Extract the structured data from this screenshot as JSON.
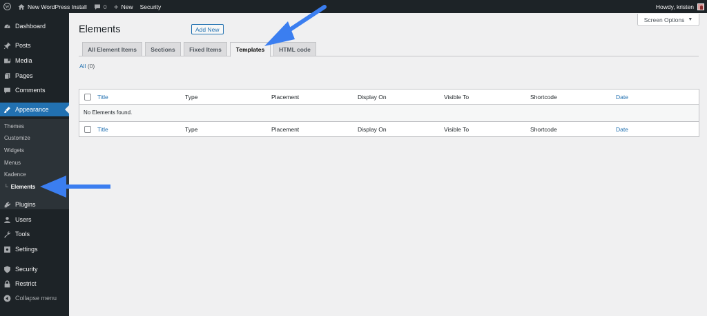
{
  "adminbar": {
    "site_name": "New WordPress Install",
    "comments_count": "0",
    "new_label": "New",
    "security_label": "Security",
    "howdy": "Howdy, kristen"
  },
  "sidebar": {
    "items": [
      {
        "label": "Dashboard",
        "icon": "dashboard-icon"
      },
      {
        "label": "Posts",
        "icon": "pin-icon"
      },
      {
        "label": "Media",
        "icon": "media-icon"
      },
      {
        "label": "Pages",
        "icon": "pages-icon"
      },
      {
        "label": "Comments",
        "icon": "comment-icon"
      },
      {
        "label": "Appearance",
        "icon": "paintbrush-icon"
      },
      {
        "label": "Plugins",
        "icon": "plugin-icon"
      },
      {
        "label": "Users",
        "icon": "users-icon"
      },
      {
        "label": "Tools",
        "icon": "wrench-icon"
      },
      {
        "label": "Settings",
        "icon": "settings-icon"
      },
      {
        "label": "Security",
        "icon": "shield-icon"
      },
      {
        "label": "Restrict",
        "icon": "lock-icon"
      },
      {
        "label": "Collapse menu",
        "icon": "collapse-icon"
      }
    ],
    "submenu": [
      "Themes",
      "Customize",
      "Widgets",
      "Menus",
      "Kadence",
      "Elements"
    ],
    "submenu_marker": "└"
  },
  "page": {
    "title": "Elements",
    "add_new": "Add New",
    "screen_options": "Screen Options",
    "tabs": [
      "All Element Items",
      "Sections",
      "Fixed Items",
      "Templates",
      "HTML code"
    ],
    "active_tab": "Templates",
    "filter_all": "All",
    "filter_count": "(0)"
  },
  "table": {
    "columns": [
      "Title",
      "Type",
      "Placement",
      "Display On",
      "Visible To",
      "Shortcode",
      "Date"
    ],
    "empty_message": "No Elements found."
  },
  "colors": {
    "accent": "#2271b1",
    "adminbar_bg": "#1d2327",
    "arrow": "#3b7ef0"
  }
}
